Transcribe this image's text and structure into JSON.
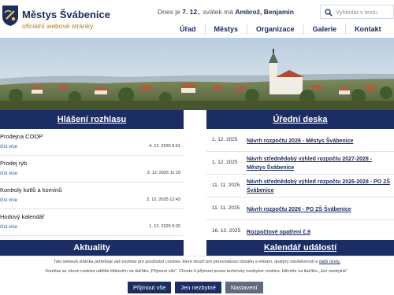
{
  "header": {
    "site_name": "Městys Švábenice",
    "site_subtitle": "oficiální webové stránky",
    "today_prefix": "Dnes je",
    "today_date": "7. 12.",
    "today_mid": ", svátek má",
    "today_names": "Ambrož, Benjamin",
    "search": {
      "placeholder": "Vyhledat v textu",
      "value": ""
    },
    "nav": [
      "Úřad",
      "Městys",
      "Organizace",
      "Galerie",
      "Kontakt"
    ]
  },
  "notices": {
    "title": "Hlášení rozhlasu",
    "more_label": "číst více",
    "items": [
      {
        "title": "Prodejna COOP",
        "date": "4. 12. 2025 8:51"
      },
      {
        "title": "Prodej ryb",
        "date": "3. 12. 2025 11:10"
      },
      {
        "title": "Kontroly kotlů a komínů",
        "date": "2. 12. 2025 12:43"
      },
      {
        "title": "Hodový kalendář",
        "date": "1. 12. 2025 9:20"
      }
    ]
  },
  "board": {
    "title": "Úřední deska",
    "items": [
      {
        "date": "1. 12. 2025",
        "title": "Návrh rozpočtu 2026 - Městys Švábenice"
      },
      {
        "date": "1. 12. 2025",
        "title": "Návrh střednědobý výhled rozpočtu 2027-2028 - Městys Švábenice"
      },
      {
        "date": "11. 11. 2025",
        "title": "Návrh střednědobý výhled rozpočtu 2026-2028 - PO ZŠ Švábenice"
      },
      {
        "date": "11. 11. 2025",
        "title": "Návrh rozpočtu 2026 - PO ZŠ Švábenice"
      },
      {
        "date": "16. 10. 2025",
        "title": "Rozpočtové opatření č.9"
      }
    ]
  },
  "sections": {
    "news": "Aktuality",
    "events": "Kalendář událostí"
  },
  "cookie": {
    "line1": "Tato webová stránka potřebuje váš souhlas pro používání cookies, které slouží pro personalizaci obsahu a reklam, analýzy návštěvnosti a",
    "line1_link": "další účely.",
    "line2": "Souhlas se všemi cookies udělíte kliknutím na tlačítko „Přijmout vše“. Chcete-li přijmout pouze technicky nezbytné cookies, klikněte na tlačítko „Jen nezbytné“.",
    "accept": "Přijmout vše",
    "necessary": "Jen nezbytné",
    "settings": "Nastavení"
  },
  "colors": {
    "primary": "#1b2d63",
    "accent": "#c07a17",
    "link": "#2d4aa0"
  }
}
